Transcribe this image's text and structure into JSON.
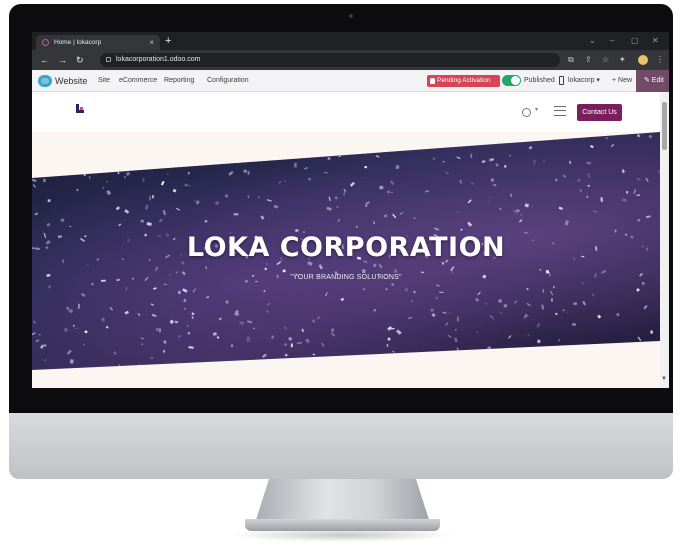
{
  "browser": {
    "tab_title": "Home | lokacorp",
    "tab_close": "×",
    "new_tab": "+",
    "win_controls": [
      "⌄",
      "–",
      "▢",
      "✕"
    ],
    "url": "lokacorporation1.odoo.com"
  },
  "odoo_bar": {
    "app": "Website",
    "menu": [
      "Site",
      "eCommerce",
      "Reporting",
      "Configuration"
    ],
    "pending_label": "Pending Activation",
    "published_label": "Published",
    "site_select": "lokacorp ▾",
    "new_label": "+ New",
    "edit_label": "✎ Edit",
    "accent": "#714b67",
    "pending_color": "#d94356",
    "published_color": "#22a66a"
  },
  "site": {
    "contact_label": "Contact Us",
    "contact_color": "#7b1e5e"
  },
  "hero": {
    "title": "LOKA CORPORATION",
    "subtitle": "\"YOUR BRANDING SOLUTIONS\""
  }
}
